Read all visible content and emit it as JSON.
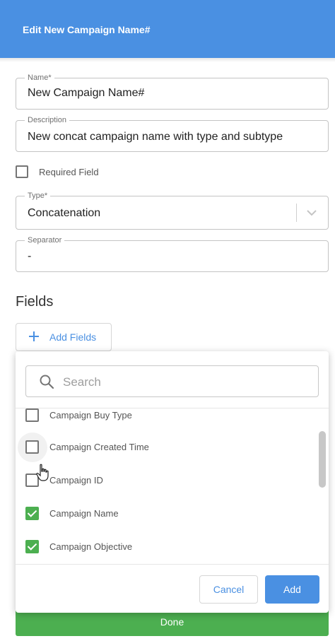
{
  "header": {
    "title": "Edit New Campaign Name#",
    "color": "#4a90e2"
  },
  "form": {
    "name": {
      "label": "Name",
      "required_mark": "*",
      "value": "New Campaign Name#"
    },
    "description": {
      "label": "Description",
      "value": "New concat campaign name with type and subtype"
    },
    "required_field": {
      "label": "Required Field",
      "checked": false
    },
    "type": {
      "label": "Type",
      "required_mark": "*",
      "value": "Concatenation",
      "icon": "chevron-down-icon"
    },
    "separator": {
      "label": "Separator",
      "value": "-"
    }
  },
  "fields_section": {
    "heading": "Fields",
    "add_fields_label": "Add Fields",
    "add_icon": "plus-icon"
  },
  "field_picker": {
    "search": {
      "placeholder": "Search",
      "icon": "search-icon"
    },
    "items": [
      {
        "label": "Campaign Buy Type",
        "checked": false
      },
      {
        "label": "Campaign Created Time",
        "checked": false
      },
      {
        "label": "Campaign ID",
        "checked": false
      },
      {
        "label": "Campaign Name",
        "checked": true
      },
      {
        "label": "Campaign Objective",
        "checked": true
      }
    ],
    "cancel_label": "Cancel",
    "add_label": "Add"
  },
  "footer": {
    "done_label": "Done",
    "color": "#4caf50"
  }
}
